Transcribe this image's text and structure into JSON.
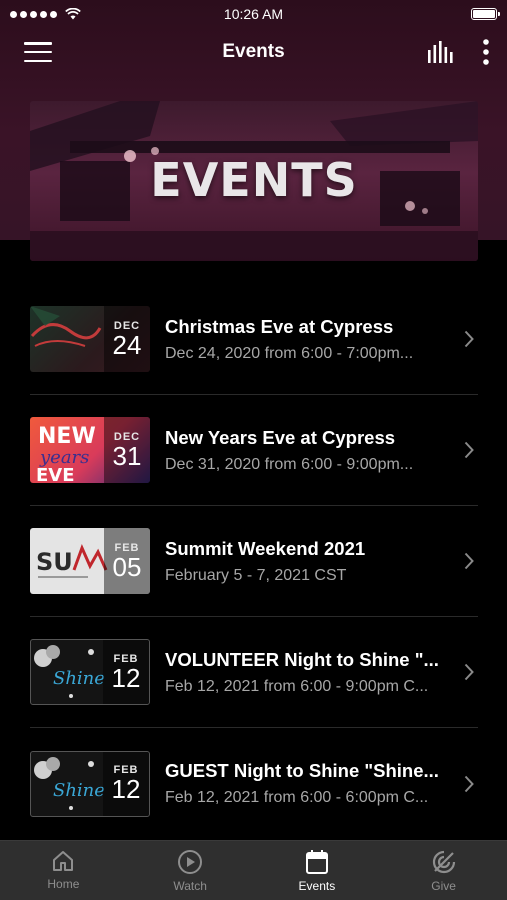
{
  "status_bar": {
    "time": "10:26 AM"
  },
  "nav": {
    "title": "Events"
  },
  "banner": {
    "title": "EVENTS"
  },
  "events": [
    {
      "month": "DEC",
      "day": "24",
      "title": "Christmas Eve at Cypress",
      "subtitle": "Dec 24, 2020 from 6:00 - 7:00pm..."
    },
    {
      "month": "DEC",
      "day": "31",
      "title": "New Years Eve at Cypress",
      "subtitle": "Dec 31, 2020 from 6:00 - 9:00pm..."
    },
    {
      "month": "FEB",
      "day": "05",
      "title": "Summit Weekend 2021",
      "subtitle": "February 5 - 7, 2021 CST"
    },
    {
      "month": "FEB",
      "day": "12",
      "title": "VOLUNTEER  Night to Shine \"...",
      "subtitle": "Feb 12, 2021 from 6:00 - 9:00pm C..."
    },
    {
      "month": "FEB",
      "day": "12",
      "title": "GUEST Night to Shine \"Shine...",
      "subtitle": "Feb 12, 2021 from 6:00 - 6:00pm C..."
    }
  ],
  "tabs": [
    {
      "label": "Home",
      "icon": "home-icon"
    },
    {
      "label": "Watch",
      "icon": "play-icon"
    },
    {
      "label": "Events",
      "icon": "calendar-icon",
      "active": true
    },
    {
      "label": "Give",
      "icon": "give-icon"
    }
  ],
  "colors": {
    "header_bg": "#3a1327",
    "background": "#000000",
    "tab_bar": "#2f2f2f",
    "subtext": "#a7a7a7"
  }
}
